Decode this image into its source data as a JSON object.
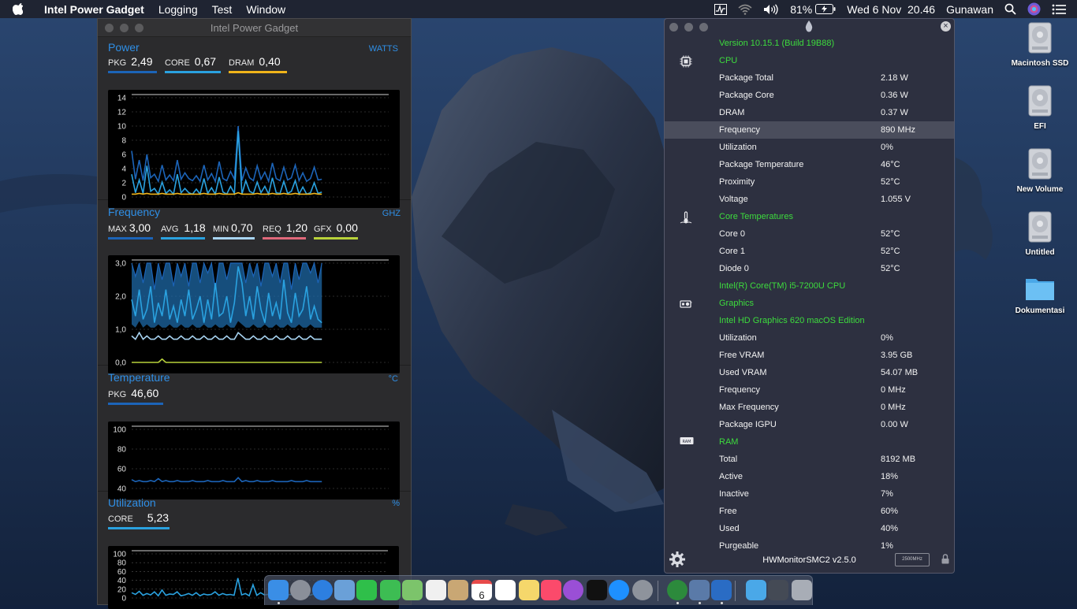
{
  "menubar": {
    "app_name": "Intel Power Gadget",
    "menus": [
      "Logging",
      "Test",
      "Window"
    ],
    "battery_percent": "81%",
    "datetime": "Wed 6 Nov  20.46",
    "user": "Gunawan"
  },
  "ipg": {
    "title": "Intel Power Gadget",
    "power": {
      "title": "Power",
      "unit": "WATTS",
      "metrics": [
        {
          "label": "PKG",
          "value": "2,49",
          "color": "#1c64b8"
        },
        {
          "label": "CORE",
          "value": "0,67",
          "color": "#2aa2e0"
        },
        {
          "label": "DRAM",
          "value": "0,40",
          "color": "#f0b41a"
        }
      ],
      "y_ticks": [
        "14",
        "12",
        "10",
        "8",
        "6",
        "4",
        "2",
        "0"
      ]
    },
    "frequency": {
      "title": "Frequency",
      "unit": "GHZ",
      "metrics": [
        {
          "label": "MAX",
          "value": "3,00",
          "color": "#1c64b8"
        },
        {
          "label": "AVG",
          "value": "1,18",
          "color": "#2aa2e0"
        },
        {
          "label": "MIN",
          "value": "0,70",
          "color": "#a8d4f2"
        },
        {
          "label": "REQ",
          "value": "1,20",
          "color": "#e0687a"
        },
        {
          "label": "GFX",
          "value": "0,00",
          "color": "#b8d23a"
        }
      ],
      "y_ticks": [
        "3,0",
        "2,0",
        "1,0",
        "0,0"
      ]
    },
    "temperature": {
      "title": "Temperature",
      "unit": "°C",
      "metrics": [
        {
          "label": "PKG",
          "value": "46,60",
          "color": "#1c64b8"
        }
      ],
      "y_ticks": [
        "100",
        "80",
        "60",
        "40"
      ]
    },
    "utilization": {
      "title": "Utilization",
      "unit": "%",
      "metrics": [
        {
          "label": "CORE",
          "value": "5,23",
          "color": "#2aa2e0"
        }
      ],
      "y_ticks": [
        "100",
        "80",
        "60",
        "40",
        "20",
        "0"
      ]
    }
  },
  "hwmonitor": {
    "rows": [
      {
        "label": "Version 10.15.1 (Build 19B88)",
        "value": "",
        "style": "green",
        "icon": ""
      },
      {
        "label": "CPU",
        "value": "",
        "style": "header",
        "icon": "cpu-icon"
      },
      {
        "label": "Package Total",
        "value": "2.18 W",
        "style": "",
        "icon": ""
      },
      {
        "label": "Package Core",
        "value": "0.36 W",
        "style": "",
        "icon": ""
      },
      {
        "label": "DRAM",
        "value": "0.37 W",
        "style": "",
        "icon": ""
      },
      {
        "label": "Frequency",
        "value": "890 MHz",
        "style": "selected",
        "icon": ""
      },
      {
        "label": "Utilization",
        "value": "0%",
        "style": "",
        "icon": ""
      },
      {
        "label": "Package Temperature",
        "value": "46°C",
        "style": "",
        "icon": ""
      },
      {
        "label": "Proximity",
        "value": "52°C",
        "style": "",
        "icon": ""
      },
      {
        "label": "Voltage",
        "value": "1.055 V",
        "style": "",
        "icon": ""
      },
      {
        "label": "Core Temperatures",
        "value": "",
        "style": "header",
        "icon": "thermometer-icon"
      },
      {
        "label": "Core 0",
        "value": "52°C",
        "style": "",
        "icon": ""
      },
      {
        "label": "Core 1",
        "value": "52°C",
        "style": "",
        "icon": ""
      },
      {
        "label": "Diode 0",
        "value": "52°C",
        "style": "",
        "icon": ""
      },
      {
        "label": "Intel(R) Core(TM) i5-7200U CPU",
        "value": "",
        "style": "green",
        "icon": ""
      },
      {
        "label": "Graphics",
        "value": "",
        "style": "header",
        "icon": "gpu-icon"
      },
      {
        "label": "Intel HD Graphics 620 macOS Edition",
        "value": "",
        "style": "green",
        "icon": ""
      },
      {
        "label": "Utilization",
        "value": "0%",
        "style": "",
        "icon": ""
      },
      {
        "label": "Free VRAM",
        "value": "3.95 GB",
        "style": "",
        "icon": ""
      },
      {
        "label": "Used VRAM",
        "value": "54.07 MB",
        "style": "",
        "icon": ""
      },
      {
        "label": "Frequency",
        "value": "0 MHz",
        "style": "",
        "icon": ""
      },
      {
        "label": "Max Frequency",
        "value": "0 MHz",
        "style": "",
        "icon": ""
      },
      {
        "label": "Package IGPU",
        "value": "0.00 W",
        "style": "",
        "icon": ""
      },
      {
        "label": "RAM",
        "value": "",
        "style": "header",
        "icon": "ram-icon"
      },
      {
        "label": "Total",
        "value": "8192 MB",
        "style": "",
        "icon": ""
      },
      {
        "label": "Active",
        "value": "18%",
        "style": "",
        "icon": ""
      },
      {
        "label": "Inactive",
        "value": "7%",
        "style": "",
        "icon": ""
      },
      {
        "label": "Free",
        "value": "60%",
        "style": "",
        "icon": ""
      },
      {
        "label": "Used",
        "value": "40%",
        "style": "",
        "icon": ""
      },
      {
        "label": "Purgeable",
        "value": "1%",
        "style": "",
        "icon": ""
      }
    ],
    "footer_version": "HWMonitorSMC2 v2.5.0",
    "footer_badge": "2500MHz",
    "ram_icon_text": "RAM"
  },
  "desktop_icons": [
    {
      "label": "Macintosh SSD",
      "kind": "drive"
    },
    {
      "label": "EFI",
      "kind": "drive"
    },
    {
      "label": "New Volume",
      "kind": "drive"
    },
    {
      "label": "Untitled",
      "kind": "drive"
    },
    {
      "label": "Dokumentasi",
      "kind": "folder"
    }
  ],
  "dock": {
    "calendar_day": "6",
    "items": [
      "finder",
      "launchpad",
      "safari",
      "preview",
      "facetime",
      "messages",
      "maps",
      "photos",
      "contacts",
      "calendar",
      "reminders",
      "notes",
      "music",
      "podcasts",
      "tv",
      "app-store",
      "system-preferences",
      "hardware-monitor",
      "xcode-tools",
      "intel-power-gadget",
      "downloads",
      "display",
      "trash"
    ]
  },
  "chart_data": [
    {
      "type": "line",
      "title": "Power",
      "ylabel": "WATTS",
      "ylim": [
        0,
        14
      ],
      "series": [
        {
          "name": "PKG",
          "values": [
            6.5,
            2.5,
            5.2,
            2.3,
            6.0,
            2.7,
            3.2,
            2.2,
            4.5,
            2.4,
            3.1,
            2.3,
            5.2,
            2.5,
            3.4,
            2.6,
            2.3,
            3.0,
            2.2,
            4.5,
            2.4,
            3.3,
            2.2,
            5.0,
            2.6,
            2.3,
            3.6,
            2.5,
            10.0,
            2.3,
            4.1,
            2.7,
            2.3,
            4.4,
            2.5,
            3.5,
            2.2,
            4.8,
            2.6,
            2.3,
            4.2,
            2.4,
            2.7,
            4.5,
            2.3,
            3.4,
            2.2,
            2.6,
            4.2,
            2.4,
            2.5
          ]
        },
        {
          "name": "CORE",
          "values": [
            3.2,
            0.6,
            2.4,
            0.5,
            4.4,
            0.8,
            1.2,
            0.4,
            2.1,
            0.5,
            1.0,
            0.4,
            3.2,
            0.6,
            1.2,
            0.6,
            0.4,
            1.1,
            0.4,
            2.6,
            0.5,
            1.3,
            0.4,
            2.8,
            0.7,
            0.4,
            1.5,
            0.5,
            9.3,
            0.4,
            2.3,
            0.8,
            0.5,
            2.1,
            0.6,
            1.5,
            0.4,
            2.7,
            0.6,
            0.5,
            2.2,
            0.5,
            0.8,
            2.3,
            0.4,
            1.4,
            0.4,
            0.6,
            2.0,
            0.5,
            0.7
          ]
        },
        {
          "name": "DRAM",
          "values": [
            0.4,
            0.4,
            0.5,
            0.4,
            0.5,
            0.4,
            0.4,
            0.4,
            0.5,
            0.4,
            0.4,
            0.4,
            0.5,
            0.4,
            0.4,
            0.4,
            0.4,
            0.4,
            0.4,
            0.5,
            0.4,
            0.4,
            0.4,
            0.5,
            0.4,
            0.4,
            0.4,
            0.4,
            0.6,
            0.4,
            0.4,
            0.4,
            0.4,
            0.5,
            0.4,
            0.4,
            0.4,
            0.5,
            0.4,
            0.4,
            0.5,
            0.4,
            0.4,
            0.5,
            0.4,
            0.4,
            0.4,
            0.4,
            0.5,
            0.4,
            0.4
          ]
        }
      ]
    },
    {
      "type": "line",
      "title": "Frequency",
      "ylabel": "GHZ",
      "ylim": [
        0,
        3
      ],
      "series": [
        {
          "name": "MAX",
          "values": [
            3.0,
            2.6,
            3.0,
            2.4,
            3.0,
            3.0,
            2.2,
            3.0,
            2.5,
            3.0,
            3.0,
            2.3,
            3.0,
            2.6,
            3.0,
            2.3,
            3.0,
            3.0,
            2.4,
            3.0,
            2.7,
            3.0,
            2.2,
            3.0,
            3.0,
            2.5,
            3.0,
            3.0,
            3.0,
            3.0,
            2.4,
            3.0,
            2.6,
            3.0,
            2.3,
            3.0,
            3.0,
            2.6,
            3.0,
            2.4,
            3.0,
            3.0,
            2.2,
            3.0,
            2.5,
            3.0,
            3.0,
            2.7,
            3.0,
            2.4,
            3.0
          ]
        },
        {
          "name": "AVG",
          "values": [
            1.9,
            1.4,
            2.2,
            1.3,
            1.6,
            2.3,
            1.2,
            1.8,
            1.4,
            2.2,
            1.3,
            1.7,
            1.2,
            1.9,
            1.4,
            2.2,
            1.3,
            1.6,
            2.0,
            1.2,
            1.9,
            1.3,
            2.4,
            1.4,
            1.5,
            2.0,
            1.2,
            1.8,
            2.9,
            2.4,
            1.4,
            2.0,
            1.3,
            2.3,
            1.6,
            1.2,
            2.1,
            1.4,
            1.8,
            1.3,
            2.5,
            1.5,
            1.2,
            2.1,
            1.4,
            1.6,
            2.3,
            1.3,
            1.7,
            1.3,
            1.2
          ]
        },
        {
          "name": "MIN",
          "values": [
            0.8,
            0.7,
            0.9,
            0.7,
            0.8,
            0.7,
            0.7,
            0.8,
            0.7,
            0.7,
            0.8,
            0.7,
            0.7,
            0.8,
            0.7,
            0.7,
            0.8,
            0.7,
            0.7,
            0.8,
            0.7,
            0.7,
            0.8,
            0.7,
            0.7,
            0.8,
            0.7,
            0.7,
            0.9,
            0.8,
            0.7,
            0.7,
            0.8,
            0.7,
            0.7,
            0.8,
            0.7,
            0.7,
            0.8,
            0.7,
            0.7,
            0.8,
            0.7,
            0.7,
            0.8,
            0.7,
            0.7,
            0.8,
            0.7,
            0.7,
            0.7
          ]
        },
        {
          "name": "GFX",
          "values": [
            0.0,
            0.0,
            0.0,
            0.0,
            0.0,
            0.0,
            0.0,
            0.0,
            0.1,
            0.0,
            0.0,
            0.0,
            0.0,
            0.0,
            0.0,
            0.0,
            0.0,
            0.0,
            0.0,
            0.0,
            0.0,
            0.0,
            0.0,
            0.0,
            0.0,
            0.0,
            0.0,
            0.0,
            0.0,
            0.0,
            0.0,
            0.0,
            0.0,
            0.0,
            0.0,
            0.0,
            0.0,
            0.0,
            0.0,
            0.0,
            0.0,
            0.0,
            0.0,
            0.0,
            0.0,
            0.0,
            0.0,
            0.0,
            0.0,
            0.0,
            0.0
          ]
        }
      ]
    },
    {
      "type": "line",
      "title": "Temperature",
      "ylabel": "°C",
      "ylim": [
        30,
        110
      ],
      "series": [
        {
          "name": "PKG",
          "values": [
            49,
            47,
            48,
            47,
            47,
            48,
            47,
            50,
            47,
            48,
            47,
            47,
            48,
            47,
            47,
            47,
            48,
            47,
            47,
            47,
            48,
            47,
            47,
            47,
            48,
            47,
            47,
            47,
            51,
            47,
            48,
            47,
            47,
            48,
            47,
            47,
            47,
            48,
            47,
            47,
            47,
            47,
            48,
            47,
            47,
            47,
            48,
            47,
            47,
            47,
            47
          ]
        }
      ]
    },
    {
      "type": "line",
      "title": "Utilization",
      "ylabel": "%",
      "ylim": [
        0,
        100
      ],
      "series": [
        {
          "name": "CORE",
          "values": [
            12,
            8,
            15,
            6,
            10,
            7,
            14,
            5,
            18,
            6,
            9,
            8,
            14,
            5,
            7,
            10,
            6,
            12,
            5,
            9,
            7,
            8,
            14,
            6,
            10,
            7,
            8,
            6,
            45,
            7,
            10,
            5,
            30,
            6,
            12,
            7,
            8,
            5,
            9,
            6,
            12,
            7,
            8,
            6,
            10,
            5,
            8,
            6,
            9,
            6,
            5
          ]
        }
      ]
    }
  ]
}
